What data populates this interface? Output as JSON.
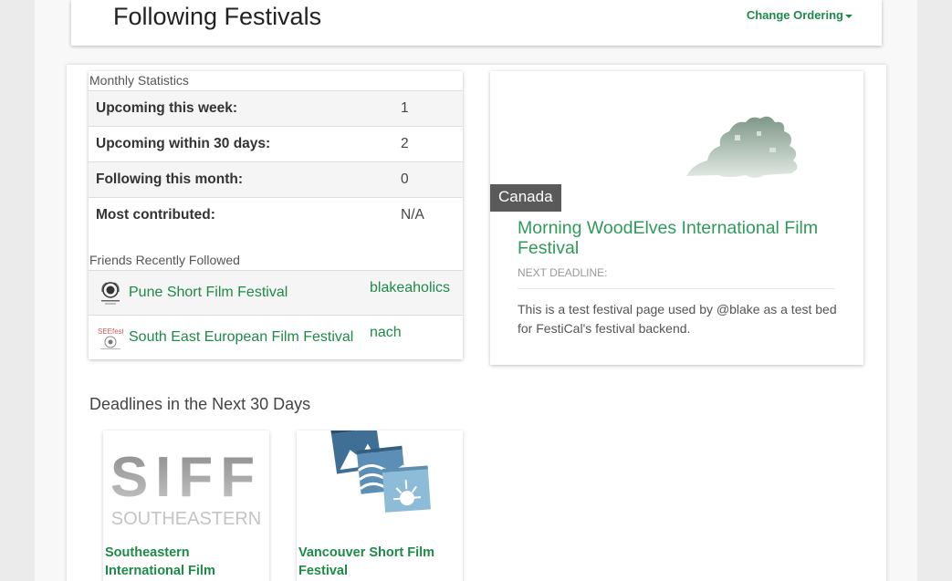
{
  "header": {
    "title": "Following Festivals",
    "ordering_label": "Change Ordering"
  },
  "stats": {
    "section_label": "Monthly Statistics",
    "rows": [
      {
        "label": "Upcoming this week:",
        "value": "1"
      },
      {
        "label": "Upcoming within 30 days:",
        "value": "2"
      },
      {
        "label": "Following this month:",
        "value": "0"
      },
      {
        "label": "Most contributed:",
        "value": "N/A"
      }
    ]
  },
  "friends": {
    "section_label": "Friends Recently Followed",
    "rows": [
      {
        "festival": "Pune Short Film Festival",
        "user": "blakeaholics"
      },
      {
        "festival": "South East European Film Festival",
        "user": "nach"
      }
    ]
  },
  "featured": {
    "country": "Canada",
    "name": "Morning WoodElves International Film Festival",
    "deadline_label": "NEXT DEADLINE:",
    "description": "This is a test festival page used by @blake as a test bed for FestiCal's festival backend."
  },
  "deadlines": {
    "title": "Deadlines in the Next 30 Days",
    "cards": [
      {
        "name": "Southeastern International Film Festival",
        "logo_text": "SIFF",
        "logo_sub": "SOUTHEASTERN"
      },
      {
        "name": "Vancouver Short Film Festival"
      }
    ]
  },
  "colors": {
    "accent": "#1e8a47",
    "festival_title": "#2f9a5a",
    "country_badge": "#5a5a5a"
  }
}
